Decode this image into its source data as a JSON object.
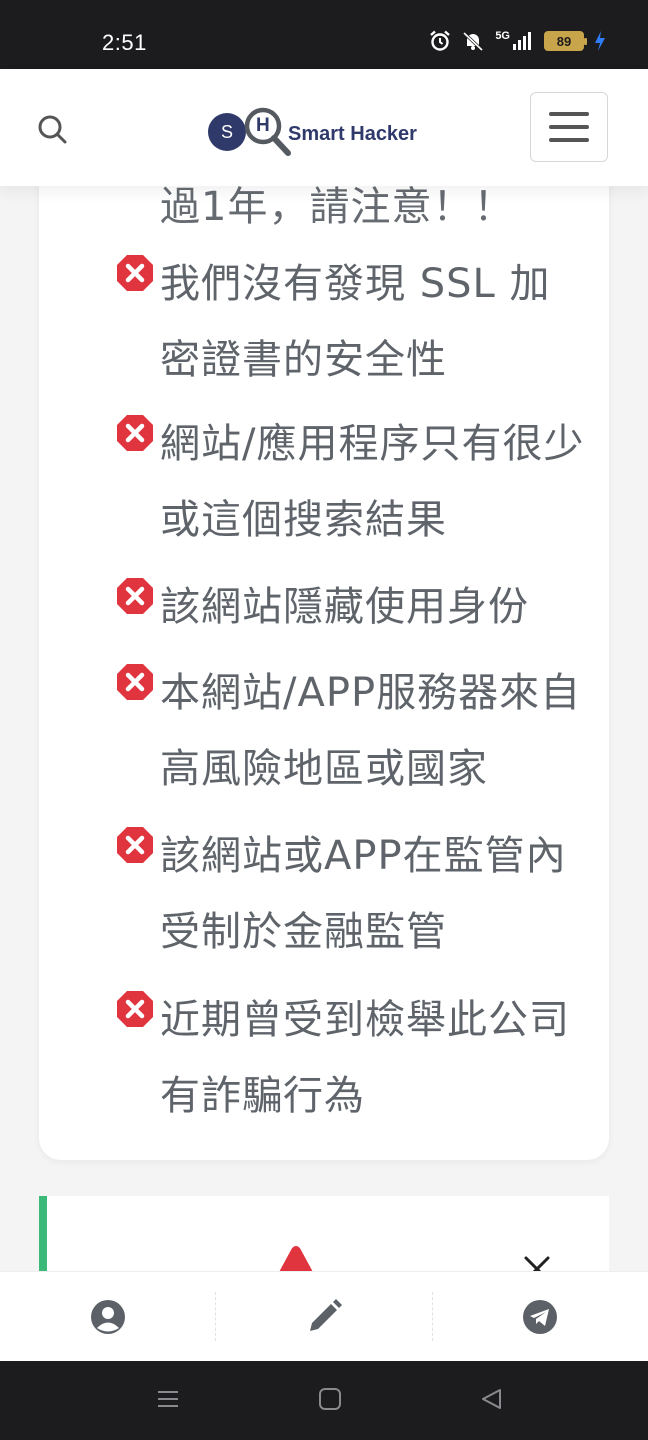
{
  "status_bar": {
    "time": "2:51",
    "network": "5G",
    "battery": "89"
  },
  "header": {
    "logo": {
      "letter_s": "S",
      "letter_h": "H",
      "brand": "Smart Hacker"
    }
  },
  "card": {
    "cut_line": "過1年，請注意！！",
    "items": [
      {
        "text": "我們沒有發現 SSL 加密證書的安全性"
      },
      {
        "text": "網站/應用程序只有很少或這個搜索結果"
      },
      {
        "text": "該網站隱藏使用身份"
      },
      {
        "text": "本網站/APP服務器來自高風險地區或國家"
      },
      {
        "text": "該網站或APP在監管內受制於金融監管"
      },
      {
        "text": "近期曾受到檢舉此公司有詐騙行為"
      }
    ]
  },
  "colors": {
    "accent_green": "#3cb878",
    "danger_red": "#e0343e",
    "brand_navy": "#2f3a6b",
    "text_gray": "#5f646b",
    "icon_gray": "#5c6168"
  },
  "bottom_nav": [
    {
      "icon": "user-icon"
    },
    {
      "icon": "pencil-icon"
    },
    {
      "icon": "telegram-icon"
    }
  ]
}
